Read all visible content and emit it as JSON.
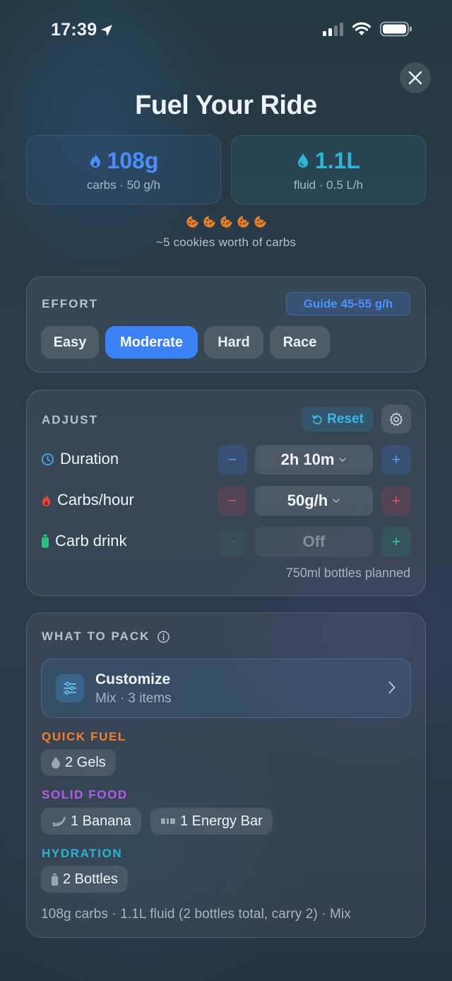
{
  "status_bar": {
    "time": "17:39"
  },
  "header": {
    "title": "Fuel Your Ride"
  },
  "stats": {
    "carbs_value": "108g",
    "carbs_sub": "carbs · 50 g/h",
    "fluid_value": "1.1L",
    "fluid_sub": "fluid · 0.5 L/h"
  },
  "cookies": {
    "count": 5,
    "note": "~5 cookies worth of carbs"
  },
  "effort": {
    "label": "EFFORT",
    "guide": "Guide 45-55 g/h",
    "options": [
      "Easy",
      "Moderate",
      "Hard",
      "Race"
    ],
    "selected": "Moderate"
  },
  "adjust": {
    "label": "ADJUST",
    "reset_label": "Reset",
    "rows": [
      {
        "label": "Duration",
        "value": "2h 10m"
      },
      {
        "label": "Carbs/hour",
        "value": "50g/h"
      },
      {
        "label": "Carb drink",
        "value": "Off"
      }
    ],
    "bottles_note": "750ml bottles planned"
  },
  "pack": {
    "label": "WHAT TO PACK",
    "customize_title": "Customize",
    "customize_sub": "Mix · 3 items",
    "groups": [
      {
        "label": "QUICK FUEL",
        "color": "#f0832a",
        "items": [
          "2 Gels"
        ]
      },
      {
        "label": "SOLID FOOD",
        "color": "#b45cf0",
        "items": [
          "1 Banana",
          "1 Energy Bar"
        ]
      },
      {
        "label": "HYDRATION",
        "color": "#2bb3cf",
        "items": [
          "2 Bottles"
        ]
      }
    ],
    "summary": "108g carbs · 1.1L fluid (2 bottles total, carry 2) · Mix"
  },
  "colors": {
    "accent_blue": "#3a82f6",
    "carbs_blue": "#4a8ff5",
    "fluid_cyan": "#2fb6d6",
    "cookie_orange": "#e0802a"
  }
}
